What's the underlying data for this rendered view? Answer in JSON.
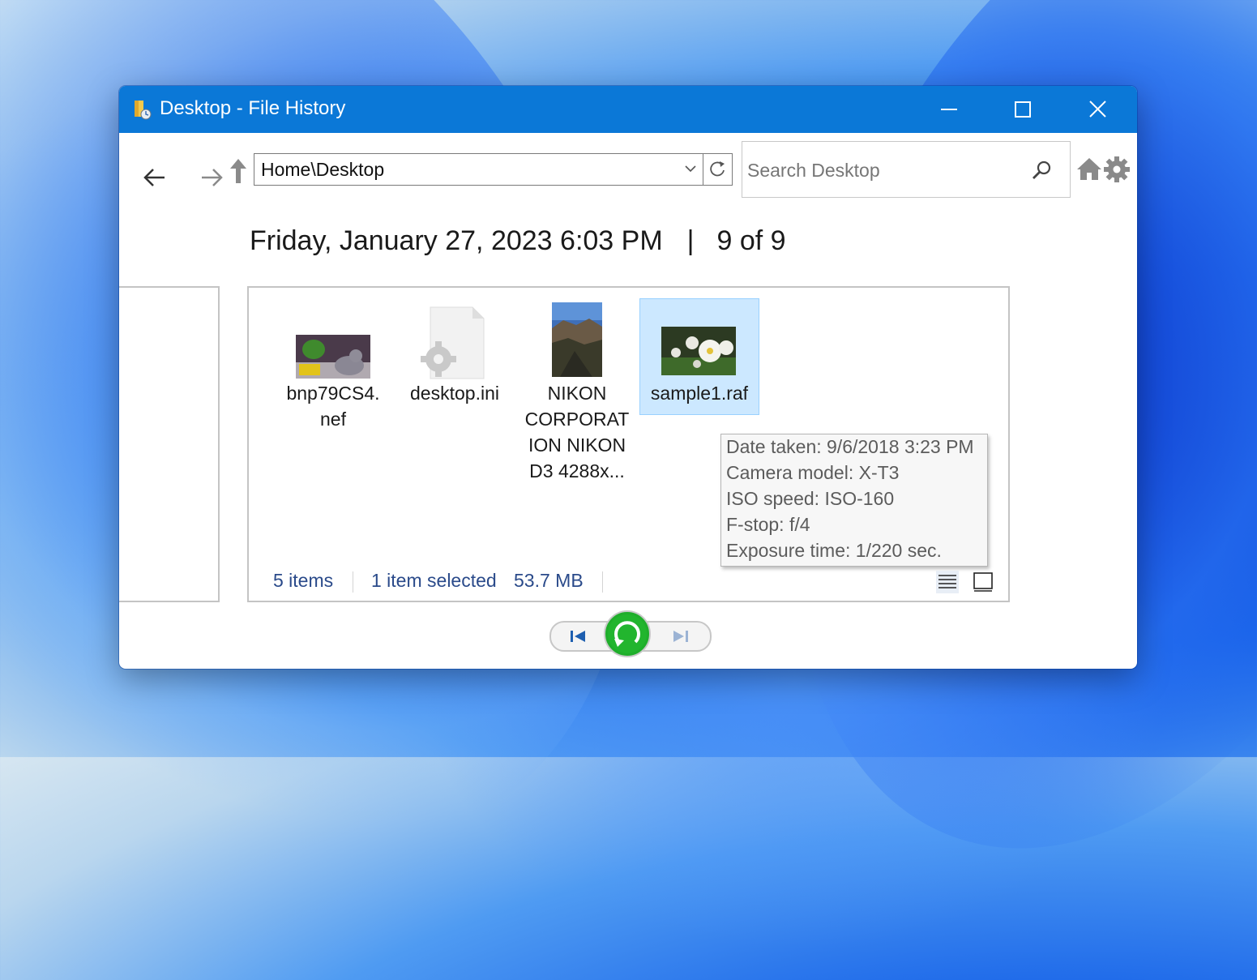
{
  "window": {
    "title": "Desktop - File History"
  },
  "toolbar": {
    "address": "Home\\Desktop",
    "search_placeholder": "Search Desktop"
  },
  "header": {
    "date": "Friday, January 27, 2023 6:03 PM",
    "separator": "|",
    "position": "9 of 9"
  },
  "files": [
    {
      "name_lines": [
        "bnp79CS4.",
        "nef"
      ],
      "icon": "photo-thumbnail"
    },
    {
      "name_lines": [
        "desktop.ini"
      ],
      "icon": "settings-file-icon"
    },
    {
      "name_lines": [
        "NIKON",
        "CORPORAT",
        "ION NIKON",
        "D3 4288x..."
      ],
      "icon": "photo-thumbnail"
    },
    {
      "name_lines": [
        "sample1.raf"
      ],
      "icon": "photo-thumbnail",
      "selected": true
    }
  ],
  "tooltip": {
    "lines": [
      "Date taken: 9/6/2018 3:23 PM",
      "Camera model: X-T3",
      "ISO speed: ISO-160",
      "F-stop: f/4",
      "Exposure time: 1/220 sec."
    ]
  },
  "status": {
    "items": "5 items",
    "selected": "1 item selected",
    "size": "53.7 MB"
  },
  "colors": {
    "titlebar": "#0b78d7",
    "selection": "#cce8ff",
    "restore": "#1fae2b"
  }
}
